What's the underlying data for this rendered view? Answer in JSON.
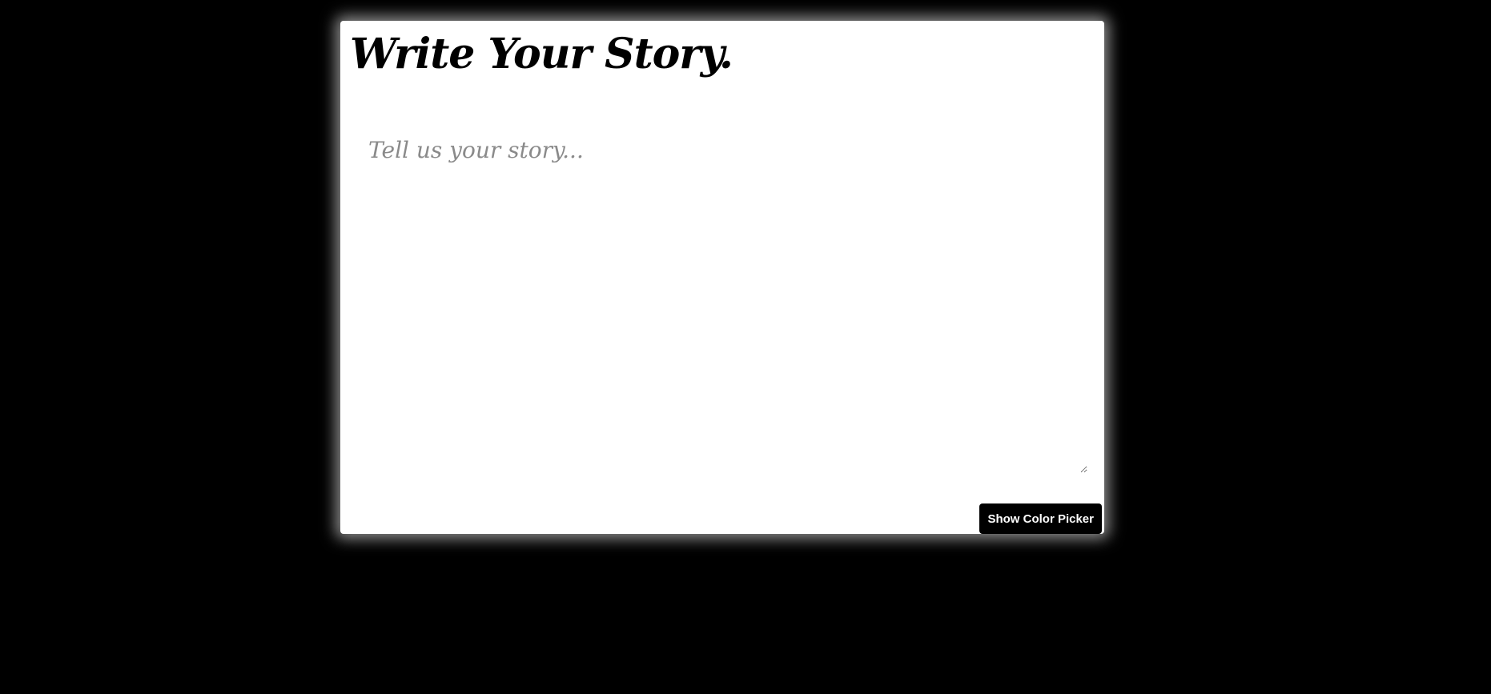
{
  "page": {
    "background_color": "#000000",
    "card_color": "#ffffff"
  },
  "header": {
    "title": "Write Your Story."
  },
  "editor": {
    "value": "",
    "placeholder": "Tell us your story..."
  },
  "actions": {
    "show_color_picker_label": "Show Color Picker"
  }
}
